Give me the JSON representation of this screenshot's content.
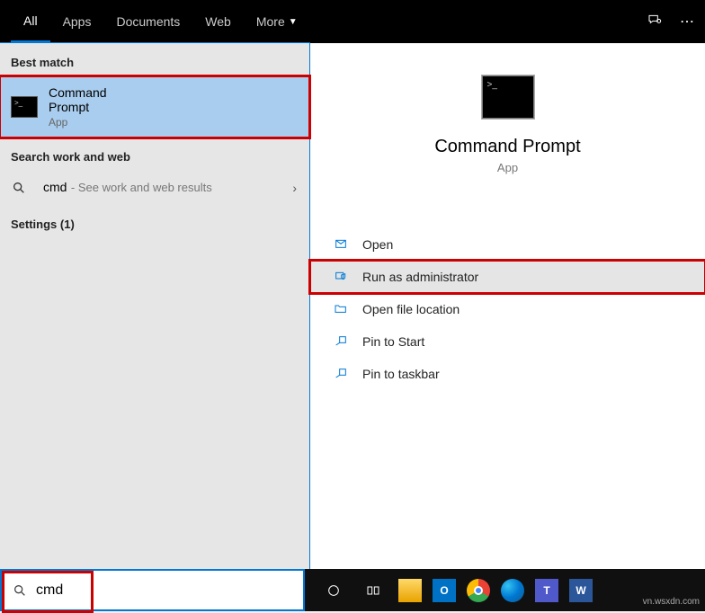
{
  "header": {
    "tabs": [
      "All",
      "Apps",
      "Documents",
      "Web"
    ],
    "more": "More"
  },
  "left": {
    "best_match_label": "Best match",
    "best_match": {
      "title": "Command Prompt",
      "sub": "App"
    },
    "search_section_label": "Search work and web",
    "search_item": {
      "query": "cmd",
      "hint": "See work and web results"
    },
    "settings_label": "Settings (1)"
  },
  "detail": {
    "title": "Command Prompt",
    "sub": "App",
    "actions": {
      "open": "Open",
      "run_admin": "Run as administrator",
      "open_file_loc": "Open file location",
      "pin_start": "Pin to Start",
      "pin_taskbar": "Pin to taskbar"
    }
  },
  "search": {
    "value": "cmd"
  },
  "watermark": "vn.wsxdn.com"
}
